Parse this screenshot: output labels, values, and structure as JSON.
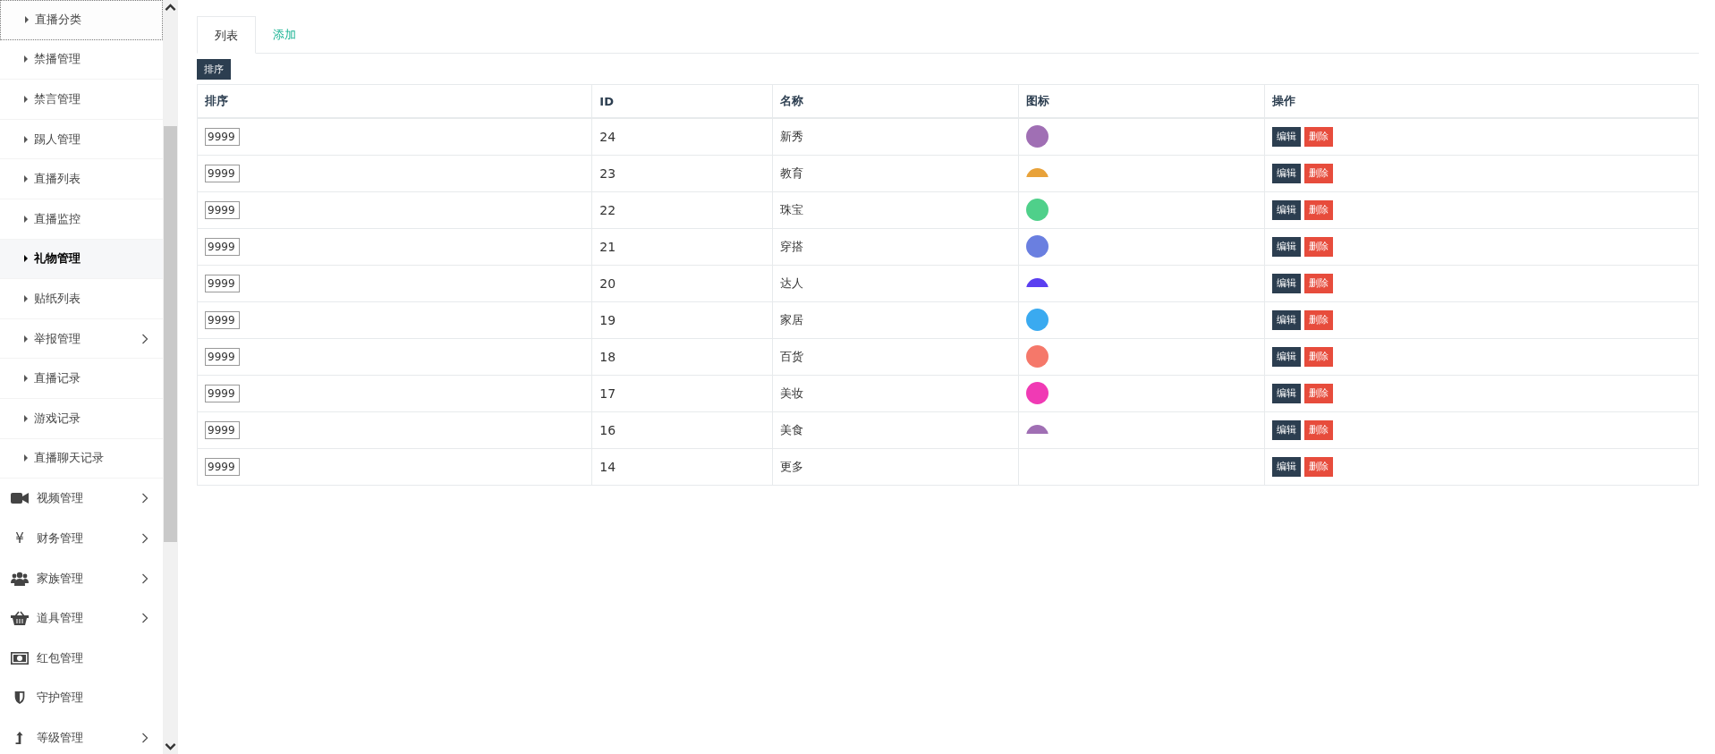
{
  "sidebar": {
    "items": [
      {
        "label": "直播分类",
        "kind": "sub",
        "selected": false,
        "focused": true,
        "has_submenu": false
      },
      {
        "label": "禁播管理",
        "kind": "sub",
        "selected": false,
        "focused": false,
        "has_submenu": false
      },
      {
        "label": "禁言管理",
        "kind": "sub",
        "selected": false,
        "focused": false,
        "has_submenu": false
      },
      {
        "label": "踢人管理",
        "kind": "sub",
        "selected": false,
        "focused": false,
        "has_submenu": false
      },
      {
        "label": "直播列表",
        "kind": "sub",
        "selected": false,
        "focused": false,
        "has_submenu": false
      },
      {
        "label": "直播监控",
        "kind": "sub",
        "selected": false,
        "focused": false,
        "has_submenu": false
      },
      {
        "label": "礼物管理",
        "kind": "sub",
        "selected": true,
        "focused": false,
        "has_submenu": false
      },
      {
        "label": "贴纸列表",
        "kind": "sub",
        "selected": false,
        "focused": false,
        "has_submenu": false
      },
      {
        "label": "举报管理",
        "kind": "sub",
        "selected": false,
        "focused": false,
        "has_submenu": true
      },
      {
        "label": "直播记录",
        "kind": "sub",
        "selected": false,
        "focused": false,
        "has_submenu": false
      },
      {
        "label": "游戏记录",
        "kind": "sub",
        "selected": false,
        "focused": false,
        "has_submenu": false
      },
      {
        "label": "直播聊天记录",
        "kind": "sub",
        "selected": false,
        "focused": false,
        "has_submenu": false
      },
      {
        "label": "视频管理",
        "kind": "video",
        "selected": false,
        "focused": false,
        "has_submenu": true
      },
      {
        "label": "财务管理",
        "kind": "yen",
        "icon_char": "¥",
        "selected": false,
        "focused": false,
        "has_submenu": true
      },
      {
        "label": "家族管理",
        "kind": "users",
        "selected": false,
        "focused": false,
        "has_submenu": true
      },
      {
        "label": "道具管理",
        "kind": "basket",
        "selected": false,
        "focused": false,
        "has_submenu": true
      },
      {
        "label": "红包管理",
        "kind": "money",
        "selected": false,
        "focused": false,
        "has_submenu": false
      },
      {
        "label": "守护管理",
        "kind": "shield",
        "selected": false,
        "focused": false,
        "has_submenu": false
      },
      {
        "label": "等级管理",
        "kind": "level",
        "selected": false,
        "focused": false,
        "has_submenu": true
      }
    ]
  },
  "tabs": [
    {
      "label": "列表",
      "selected": true
    },
    {
      "label": "添加",
      "selected": false
    }
  ],
  "sort_button": "排序",
  "table": {
    "columns": [
      "排序",
      "ID",
      "名称",
      "图标",
      "操作"
    ],
    "rows": [
      {
        "order": "9999",
        "id": "24",
        "name": "新秀",
        "icon": {
          "color": "#a06fb4",
          "clipped": false
        },
        "actions": [
          "编辑",
          "删除"
        ]
      },
      {
        "order": "9999",
        "id": "23",
        "name": "教育",
        "icon": {
          "color": "#e8a23a",
          "clipped": true
        },
        "actions": [
          "编辑",
          "删除"
        ]
      },
      {
        "order": "9999",
        "id": "22",
        "name": "珠宝",
        "icon": {
          "color": "#4fd08a",
          "clipped": false
        },
        "actions": [
          "编辑",
          "删除"
        ]
      },
      {
        "order": "9999",
        "id": "21",
        "name": "穿搭",
        "icon": {
          "color": "#6a7fe0",
          "clipped": false
        },
        "actions": [
          "编辑",
          "删除"
        ]
      },
      {
        "order": "9999",
        "id": "20",
        "name": "达人",
        "icon": {
          "color": "#5a3ff0",
          "clipped": true
        },
        "actions": [
          "编辑",
          "删除"
        ]
      },
      {
        "order": "9999",
        "id": "19",
        "name": "家居",
        "icon": {
          "color": "#3aaaf0",
          "clipped": false
        },
        "actions": [
          "编辑",
          "删除"
        ]
      },
      {
        "order": "9999",
        "id": "18",
        "name": "百货",
        "icon": {
          "color": "#f5786a",
          "clipped": false
        },
        "actions": [
          "编辑",
          "删除"
        ]
      },
      {
        "order": "9999",
        "id": "17",
        "name": "美妆",
        "icon": {
          "color": "#f03ab4",
          "clipped": false
        },
        "actions": [
          "编辑",
          "删除"
        ]
      },
      {
        "order": "9999",
        "id": "16",
        "name": "美食",
        "icon": {
          "color": "#a06fb4",
          "clipped": true
        },
        "actions": [
          "编辑",
          "删除"
        ]
      },
      {
        "order": "9999",
        "id": "14",
        "name": "更多",
        "actions": [
          "编辑",
          "删除"
        ]
      }
    ]
  }
}
